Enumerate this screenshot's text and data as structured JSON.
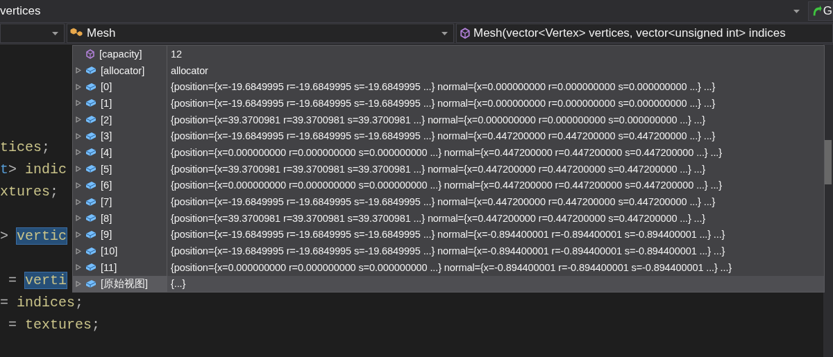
{
  "find_bar": {
    "value": "vertices",
    "go_label": "G"
  },
  "nav_bar": {
    "type_name": "Mesh",
    "member": "Mesh(vector<Vertex> vertices, vector<unsigned int> indices"
  },
  "code_lines": [
    {
      "segments": [
        {
          "text": "tices",
          "kind": "ident"
        },
        {
          "text": ";",
          "kind": "punct"
        }
      ]
    },
    {
      "segments": [
        {
          "text": "t",
          "kind": "type"
        },
        {
          "text": "> ",
          "kind": "punct"
        },
        {
          "text": "indic",
          "kind": "ident"
        }
      ]
    },
    {
      "segments": [
        {
          "text": "xtures",
          "kind": "ident"
        },
        {
          "text": ";",
          "kind": "punct"
        }
      ]
    },
    {
      "segments": [
        {
          "text": "> ",
          "kind": "punct"
        },
        {
          "text": "vertic",
          "kind": "selected"
        }
      ]
    },
    {
      "segments": [
        {
          "text": " = ",
          "kind": "punct"
        },
        {
          "text": "verti",
          "kind": "selected"
        }
      ]
    },
    {
      "segments": [
        {
          "text": "= ",
          "kind": "punct"
        },
        {
          "text": "indices",
          "kind": "ident"
        },
        {
          "text": ";",
          "kind": "punct"
        }
      ]
    },
    {
      "segments": [
        {
          "text": " = ",
          "kind": "punct"
        },
        {
          "text": "textures",
          "kind": "ident"
        },
        {
          "text": ";",
          "kind": "punct"
        }
      ]
    }
  ],
  "datatip": {
    "rows": [
      {
        "name": "[capacity]",
        "value": "12",
        "kind": "property",
        "expandable": false,
        "selected": false
      },
      {
        "name": "[allocator]",
        "value": "allocator",
        "kind": "field",
        "expandable": true,
        "selected": false
      },
      {
        "name": "[0]",
        "value": "{position={x=-19.6849995 r=-19.6849995 s=-19.6849995 ...} normal={x=0.000000000 r=0.000000000 s=0.000000000 ...} ...}",
        "kind": "field",
        "expandable": true,
        "selected": false
      },
      {
        "name": "[1]",
        "value": "{position={x=-19.6849995 r=-19.6849995 s=-19.6849995 ...} normal={x=0.000000000 r=0.000000000 s=0.000000000 ...} ...}",
        "kind": "field",
        "expandable": true,
        "selected": false
      },
      {
        "name": "[2]",
        "value": "{position={x=39.3700981 r=39.3700981 s=39.3700981 ...} normal={x=0.000000000 r=0.000000000 s=0.000000000 ...} ...}",
        "kind": "field",
        "expandable": true,
        "selected": false
      },
      {
        "name": "[3]",
        "value": "{position={x=-19.6849995 r=-19.6849995 s=-19.6849995 ...} normal={x=0.447200000 r=0.447200000 s=0.447200000 ...} ...}",
        "kind": "field",
        "expandable": true,
        "selected": false
      },
      {
        "name": "[4]",
        "value": "{position={x=0.000000000 r=0.000000000 s=0.000000000 ...} normal={x=0.447200000 r=0.447200000 s=0.447200000 ...} ...}",
        "kind": "field",
        "expandable": true,
        "selected": false
      },
      {
        "name": "[5]",
        "value": "{position={x=39.3700981 r=39.3700981 s=39.3700981 ...} normal={x=0.447200000 r=0.447200000 s=0.447200000 ...} ...}",
        "kind": "field",
        "expandable": true,
        "selected": false
      },
      {
        "name": "[6]",
        "value": "{position={x=0.000000000 r=0.000000000 s=0.000000000 ...} normal={x=0.447200000 r=0.447200000 s=0.447200000 ...} ...}",
        "kind": "field",
        "expandable": true,
        "selected": false
      },
      {
        "name": "[7]",
        "value": "{position={x=-19.6849995 r=-19.6849995 s=-19.6849995 ...} normal={x=0.447200000 r=0.447200000 s=0.447200000 ...} ...}",
        "kind": "field",
        "expandable": true,
        "selected": false
      },
      {
        "name": "[8]",
        "value": "{position={x=39.3700981 r=39.3700981 s=39.3700981 ...} normal={x=0.447200000 r=0.447200000 s=0.447200000 ...} ...}",
        "kind": "field",
        "expandable": true,
        "selected": false
      },
      {
        "name": "[9]",
        "value": "{position={x=-19.6849995 r=-19.6849995 s=-19.6849995 ...} normal={x=-0.894400001 r=-0.894400001 s=-0.894400001 ...} ...}",
        "kind": "field",
        "expandable": true,
        "selected": false
      },
      {
        "name": "[10]",
        "value": "{position={x=-19.6849995 r=-19.6849995 s=-19.6849995 ...} normal={x=-0.894400001 r=-0.894400001 s=-0.894400001 ...} ...}",
        "kind": "field",
        "expandable": true,
        "selected": false
      },
      {
        "name": "[11]",
        "value": "{position={x=0.000000000 r=0.000000000 s=0.000000000 ...} normal={x=-0.894400001 r=-0.894400001 s=-0.894400001 ...} ...}",
        "kind": "field",
        "expandable": true,
        "selected": false
      },
      {
        "name": "[原始视图]",
        "value": "{...}",
        "kind": "field",
        "expandable": true,
        "selected": true
      }
    ]
  }
}
